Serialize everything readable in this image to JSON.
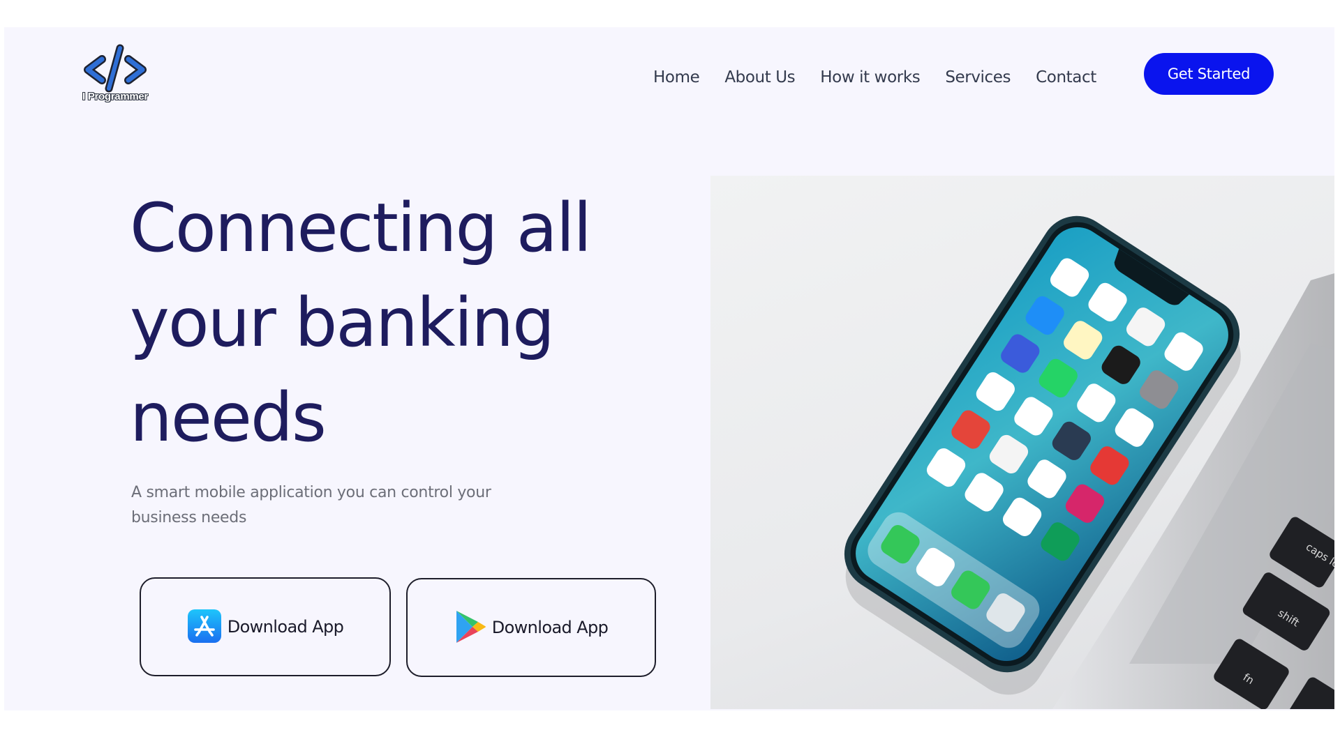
{
  "header": {
    "logo_text": "I Programmer",
    "nav": [
      "Home",
      "About Us",
      "How it works",
      "Services",
      "Contact"
    ],
    "cta_label": "Get Started"
  },
  "hero": {
    "title": "Connecting all your banking needs",
    "subtitle": "A smart mobile application you can control your business needs",
    "buttons": [
      {
        "label": "Download App",
        "icon": "app-store-icon"
      },
      {
        "label": "Download App",
        "icon": "google-play-icon"
      }
    ]
  },
  "image": {
    "description": "smartphone-on-desk-photo",
    "laptop_keys": [
      "caps lo",
      "shift",
      "fn"
    ]
  },
  "colors": {
    "accent": "#0a14ee",
    "heading": "#1e1c5e",
    "page_bg": "#f7f6fe",
    "logo_blue": "#2f6fd6"
  }
}
